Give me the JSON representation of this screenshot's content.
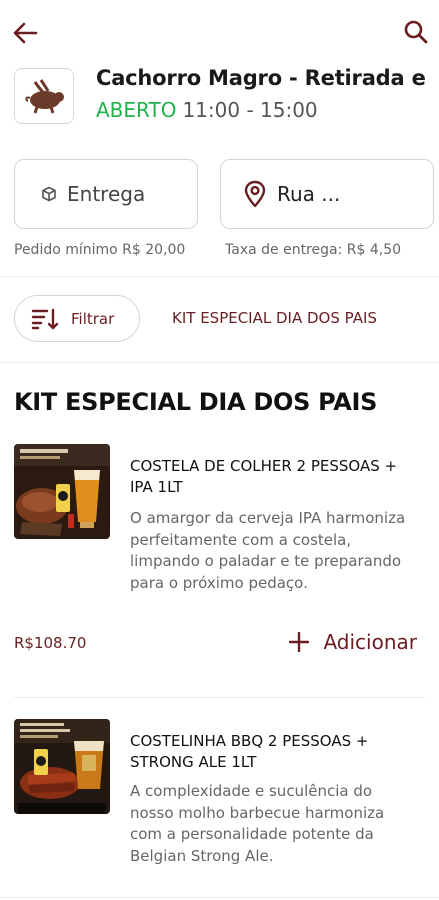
{
  "header": {
    "back_icon": "arrow-left-icon",
    "search_icon": "search-icon"
  },
  "store": {
    "name": "Cachorro Magro - Retirada e",
    "status": "ABERTO",
    "hours": "11:00 - 15:00",
    "status_color": "#22b14c",
    "logo_icon": "flying-pig-logo"
  },
  "options": {
    "delivery_label": "Entrega",
    "delivery_icon": "box-icon",
    "address_label": "Rua ...",
    "address_icon": "location-pin-icon"
  },
  "info": {
    "min_order": "Pedido mínimo R$ 20,00",
    "delivery_fee": "Taxa de entrega: R$ 4,50"
  },
  "filters": {
    "filter_label": "Filtrar",
    "filter_icon": "sort-filter-icon",
    "category_tab": "KIT ESPECIAL DIA DOS PAIS"
  },
  "section": {
    "title": "KIT ESPECIAL DIA DOS PAIS"
  },
  "products": [
    {
      "name": "COSTELA DE COLHER 2 PESSOAS + IPA 1LT",
      "description": "O amargor da cerveja IPA harmoniza perfeitamente com a costela, limpando o paladar e te preparando para o próximo pedaço.",
      "price": "R$108.70",
      "add_label": "Adicionar"
    },
    {
      "name": "COSTELINHA BBQ 2 PESSOAS + STRONG ALE 1LT",
      "description": "A complexidade e suculência do nosso molho barbecue harmoniza com a personalidade potente da Belgian Strong Ale.",
      "price": "",
      "add_label": ""
    }
  ],
  "colors": {
    "accent": "#6b1e22",
    "open": "#22b14c"
  }
}
